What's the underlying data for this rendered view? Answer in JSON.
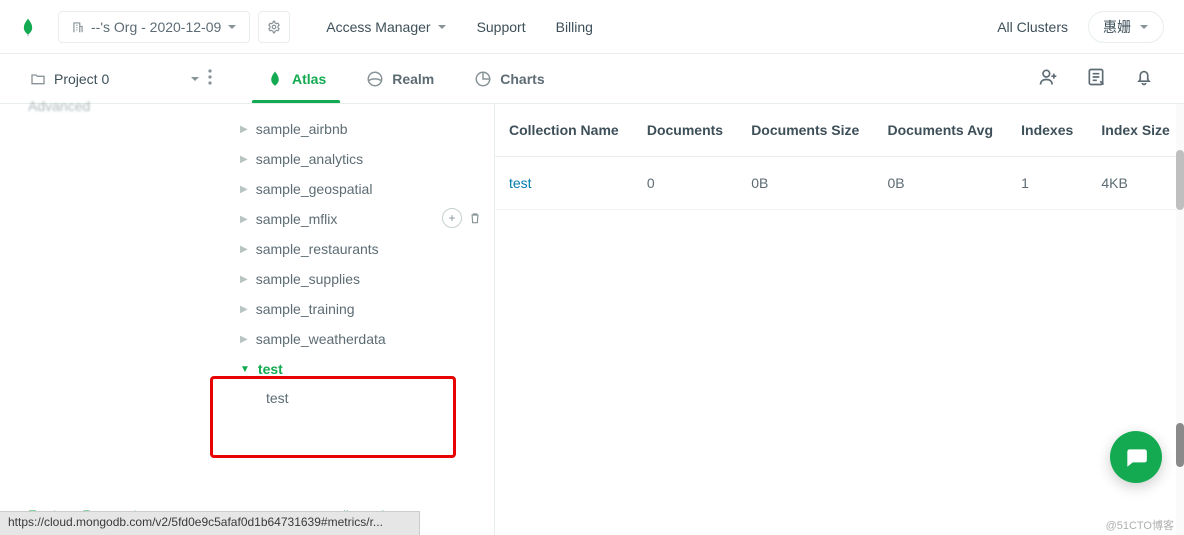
{
  "topbar": {
    "org_label": "--'s Org - 2020-12-09",
    "access_manager": "Access Manager",
    "support": "Support",
    "billing": "Billing",
    "all_clusters": "All Clusters",
    "user_name": "惠姗"
  },
  "secondbar": {
    "project_label": "Project 0",
    "tabs": {
      "atlas": "Atlas",
      "realm": "Realm",
      "charts": "Charts"
    }
  },
  "db_tree": {
    "items": [
      {
        "name": "sample_airbnb"
      },
      {
        "name": "sample_analytics"
      },
      {
        "name": "sample_geospatial"
      },
      {
        "name": "sample_mflix"
      },
      {
        "name": "sample_restaurants"
      },
      {
        "name": "sample_supplies"
      },
      {
        "name": "sample_training"
      },
      {
        "name": "sample_weatherdata"
      }
    ],
    "open_db": "test",
    "open_collection": "test"
  },
  "table": {
    "headers": {
      "name": "Collection Name",
      "docs": "Documents",
      "size": "Documents Size",
      "avg": "Documents Avg",
      "indexes": "Indexes",
      "index_size": "Index Size"
    },
    "rows": [
      {
        "name": "test",
        "docs": "0",
        "size": "0B",
        "avg": "0B",
        "indexes": "1",
        "index_size": "4KB"
      }
    ]
  },
  "footer": {
    "feature_requests": "Feature Requests",
    "status_label": "System Status:",
    "status_value": "All Good"
  },
  "urlbar": "https://cloud.mongodb.com/v2/5fd0e9c5afaf0d1b64731639#metrics/r...",
  "watermark": "@51CTO博客"
}
